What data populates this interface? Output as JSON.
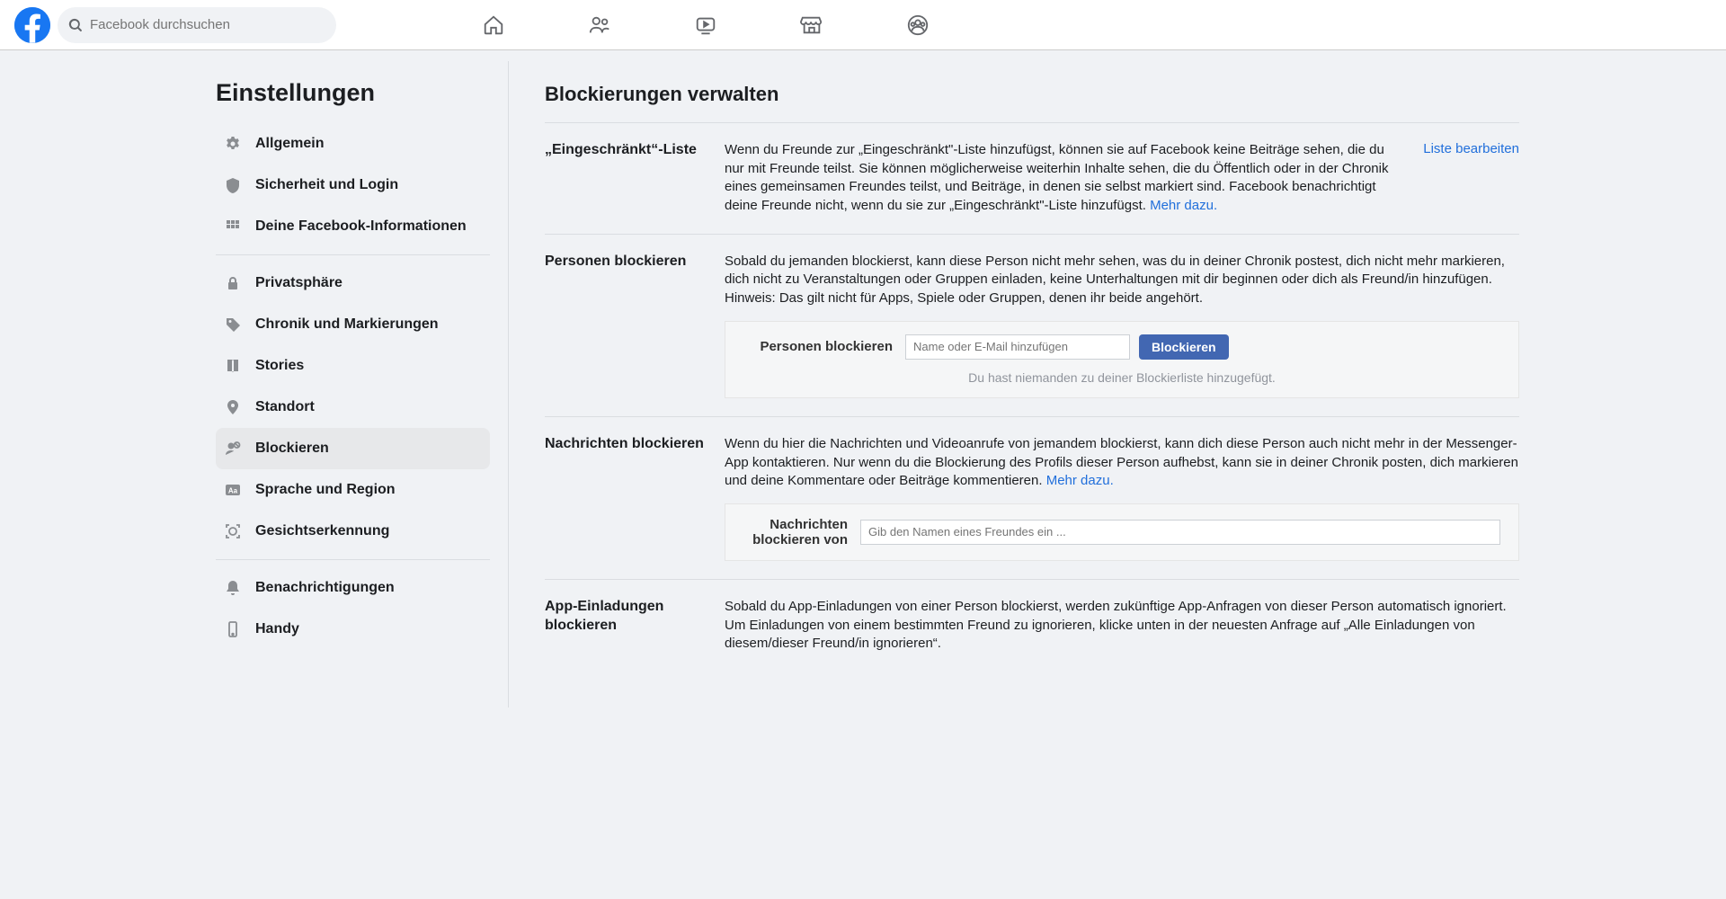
{
  "search": {
    "placeholder": "Facebook durchsuchen"
  },
  "sidebar": {
    "title": "Einstellungen",
    "groups": [
      [
        {
          "label": "Allgemein",
          "icon": "gear"
        },
        {
          "label": "Sicherheit und Login",
          "icon": "shield"
        },
        {
          "label": "Deine Facebook-Informationen",
          "icon": "grid"
        }
      ],
      [
        {
          "label": "Privatsphäre",
          "icon": "lock"
        },
        {
          "label": "Chronik und Markierungen",
          "icon": "tag"
        },
        {
          "label": "Stories",
          "icon": "book"
        },
        {
          "label": "Standort",
          "icon": "pin"
        },
        {
          "label": "Blockieren",
          "icon": "block",
          "active": true
        },
        {
          "label": "Sprache und Region",
          "icon": "aa"
        },
        {
          "label": "Gesichtserkennung",
          "icon": "face"
        }
      ],
      [
        {
          "label": "Benachrichtigungen",
          "icon": "bell"
        },
        {
          "label": "Handy",
          "icon": "phone"
        }
      ]
    ]
  },
  "main": {
    "title": "Blockierungen verwalten",
    "sections": {
      "restricted": {
        "title": "„Eingeschränkt“-Liste",
        "desc": "Wenn du Freunde zur „Eingeschränkt\"-Liste hinzufügst, können sie auf Facebook keine Beiträge sehen, die du nur mit Freunde teilst. Sie können möglicherweise weiterhin Inhalte sehen, die du Öffentlich oder in der Chronik eines gemeinsamen Freundes teilst, und Beiträge, in denen sie selbst markiert sind. Facebook benachrichtigt deine Freunde nicht, wenn du sie zur „Eingeschränkt\"-Liste hinzufügst. ",
        "more": "Mehr dazu.",
        "action": "Liste bearbeiten"
      },
      "blockUsers": {
        "title": "Personen blockieren",
        "desc": "Sobald du jemanden blockierst, kann diese Person nicht mehr sehen, was du in deiner Chronik postest, dich nicht mehr markieren, dich nicht zu Veranstaltungen oder Gruppen einladen, keine Unterhaltungen mit dir beginnen oder dich als Freund/in hinzufügen. Hinweis: Das gilt nicht für Apps, Spiele oder Gruppen, denen ihr beide angehört.",
        "inputLabel": "Personen blockieren",
        "inputPlaceholder": "Name oder E-Mail hinzufügen",
        "button": "Blockieren",
        "note": "Du hast niemanden zu deiner Blockierliste hinzugefügt."
      },
      "blockMessages": {
        "title": "Nachrichten blockieren",
        "desc": "Wenn du hier die Nachrichten und Videoanrufe von jemandem blockierst, kann dich diese Person auch nicht mehr in der Messenger-App kontaktieren. Nur wenn du die Blockierung des Profils dieser Person aufhebst, kann sie in deiner Chronik posten, dich markieren und deine Kommentare oder Beiträge kommentieren. ",
        "more": "Mehr dazu.",
        "inputLabel": "Nachrichten blockieren von",
        "inputPlaceholder": "Gib den Namen eines Freundes ein ..."
      },
      "blockAppInvites": {
        "title": "App-Einladungen blockieren",
        "desc": "Sobald du App-Einladungen von einer Person blockierst, werden zukünftige App-Anfragen von dieser Person automatisch ignoriert. Um Einladungen von einem bestimmten Freund zu ignorieren, klicke unten in der neuesten Anfrage auf „Alle Einladungen von diesem/dieser Freund/in ignorieren“."
      }
    }
  }
}
